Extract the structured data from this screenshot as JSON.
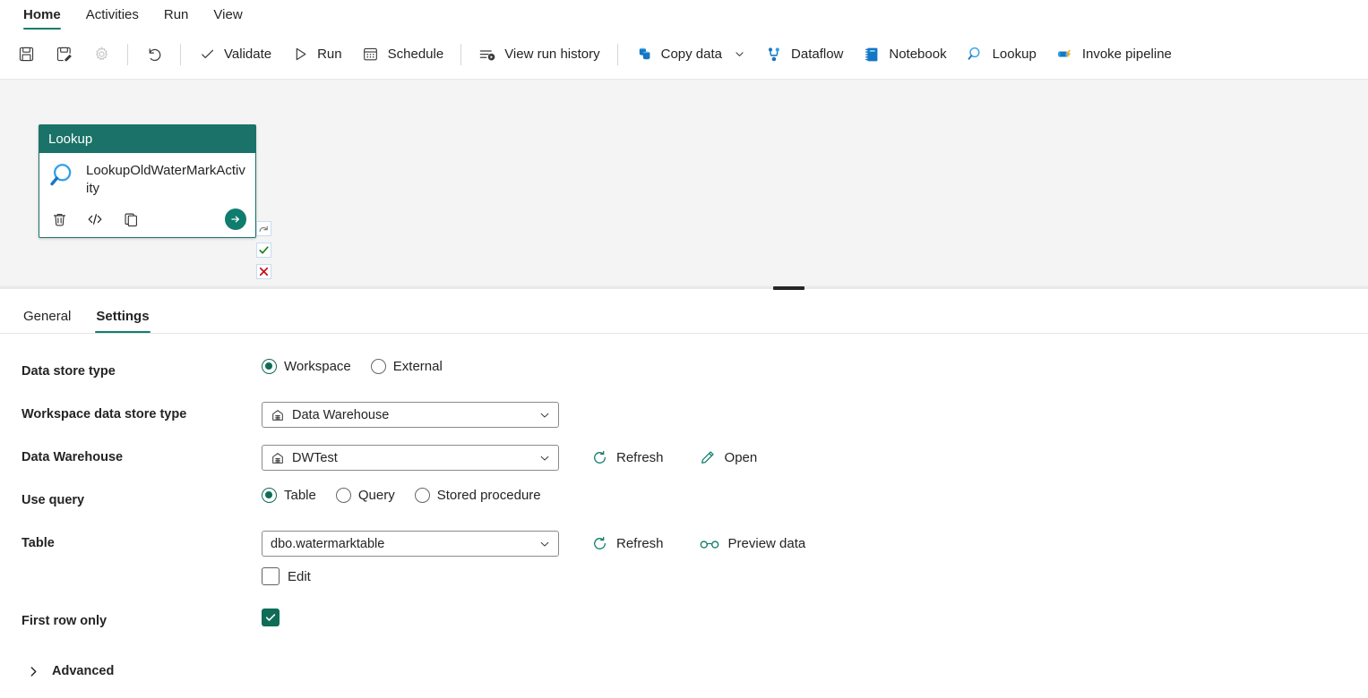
{
  "ribbon": {
    "tabs": [
      {
        "label": "Home",
        "active": true
      },
      {
        "label": "Activities",
        "active": false
      },
      {
        "label": "Run",
        "active": false
      },
      {
        "label": "View",
        "active": false
      }
    ]
  },
  "toolbar": {
    "save_label": "",
    "save_as_label": "",
    "settings_label": "",
    "undo_label": "",
    "validate_label": "Validate",
    "run_label": "Run",
    "schedule_label": "Schedule",
    "view_run_history_label": "View run history",
    "copy_data_label": "Copy data",
    "dataflow_label": "Dataflow",
    "notebook_label": "Notebook",
    "lookup_label": "Lookup",
    "invoke_pipeline_label": "Invoke pipeline"
  },
  "canvas": {
    "activity": {
      "type_label": "Lookup",
      "name": "LookupOldWaterMarkActivity",
      "footer_icons": [
        "delete-icon",
        "code-icon",
        "duplicate-icon"
      ],
      "run_button_label": ""
    },
    "connectors": [
      {
        "name": "on-skip",
        "glyph": "⤷"
      },
      {
        "name": "on-success",
        "glyph": "✓"
      },
      {
        "name": "on-failure",
        "glyph": "✕"
      },
      {
        "name": "on-completion",
        "glyph": "→"
      }
    ]
  },
  "details": {
    "tabs": [
      {
        "label": "General",
        "active": false
      },
      {
        "label": "Settings",
        "active": true
      }
    ]
  },
  "settings": {
    "data_store_type": {
      "label": "Data store type",
      "options": [
        "Workspace",
        "External"
      ],
      "selected": "Workspace"
    },
    "workspace_data_store_type": {
      "label": "Workspace data store type",
      "value": "Data Warehouse",
      "icon": "warehouse-icon"
    },
    "data_warehouse": {
      "label": "Data Warehouse",
      "value": "DWTest",
      "icon": "warehouse-icon",
      "refresh_label": "Refresh",
      "open_label": "Open"
    },
    "use_query": {
      "label": "Use query",
      "options": [
        "Table",
        "Query",
        "Stored procedure"
      ],
      "selected": "Table"
    },
    "table": {
      "label": "Table",
      "value": "dbo.watermarktable",
      "refresh_label": "Refresh",
      "preview_label": "Preview data",
      "edit_label": "Edit",
      "edit_checked": false
    },
    "first_row_only": {
      "label": "First row only",
      "checked": true
    },
    "advanced": {
      "label": "Advanced",
      "expanded": false
    }
  },
  "colors": {
    "accent_teal": "#107c6e",
    "card_header": "#1a7268",
    "radio_teal": "#0f6c56",
    "icon_blue": "#0f6cbd",
    "error_red": "#c50f1f",
    "success_green": "#107c10"
  }
}
